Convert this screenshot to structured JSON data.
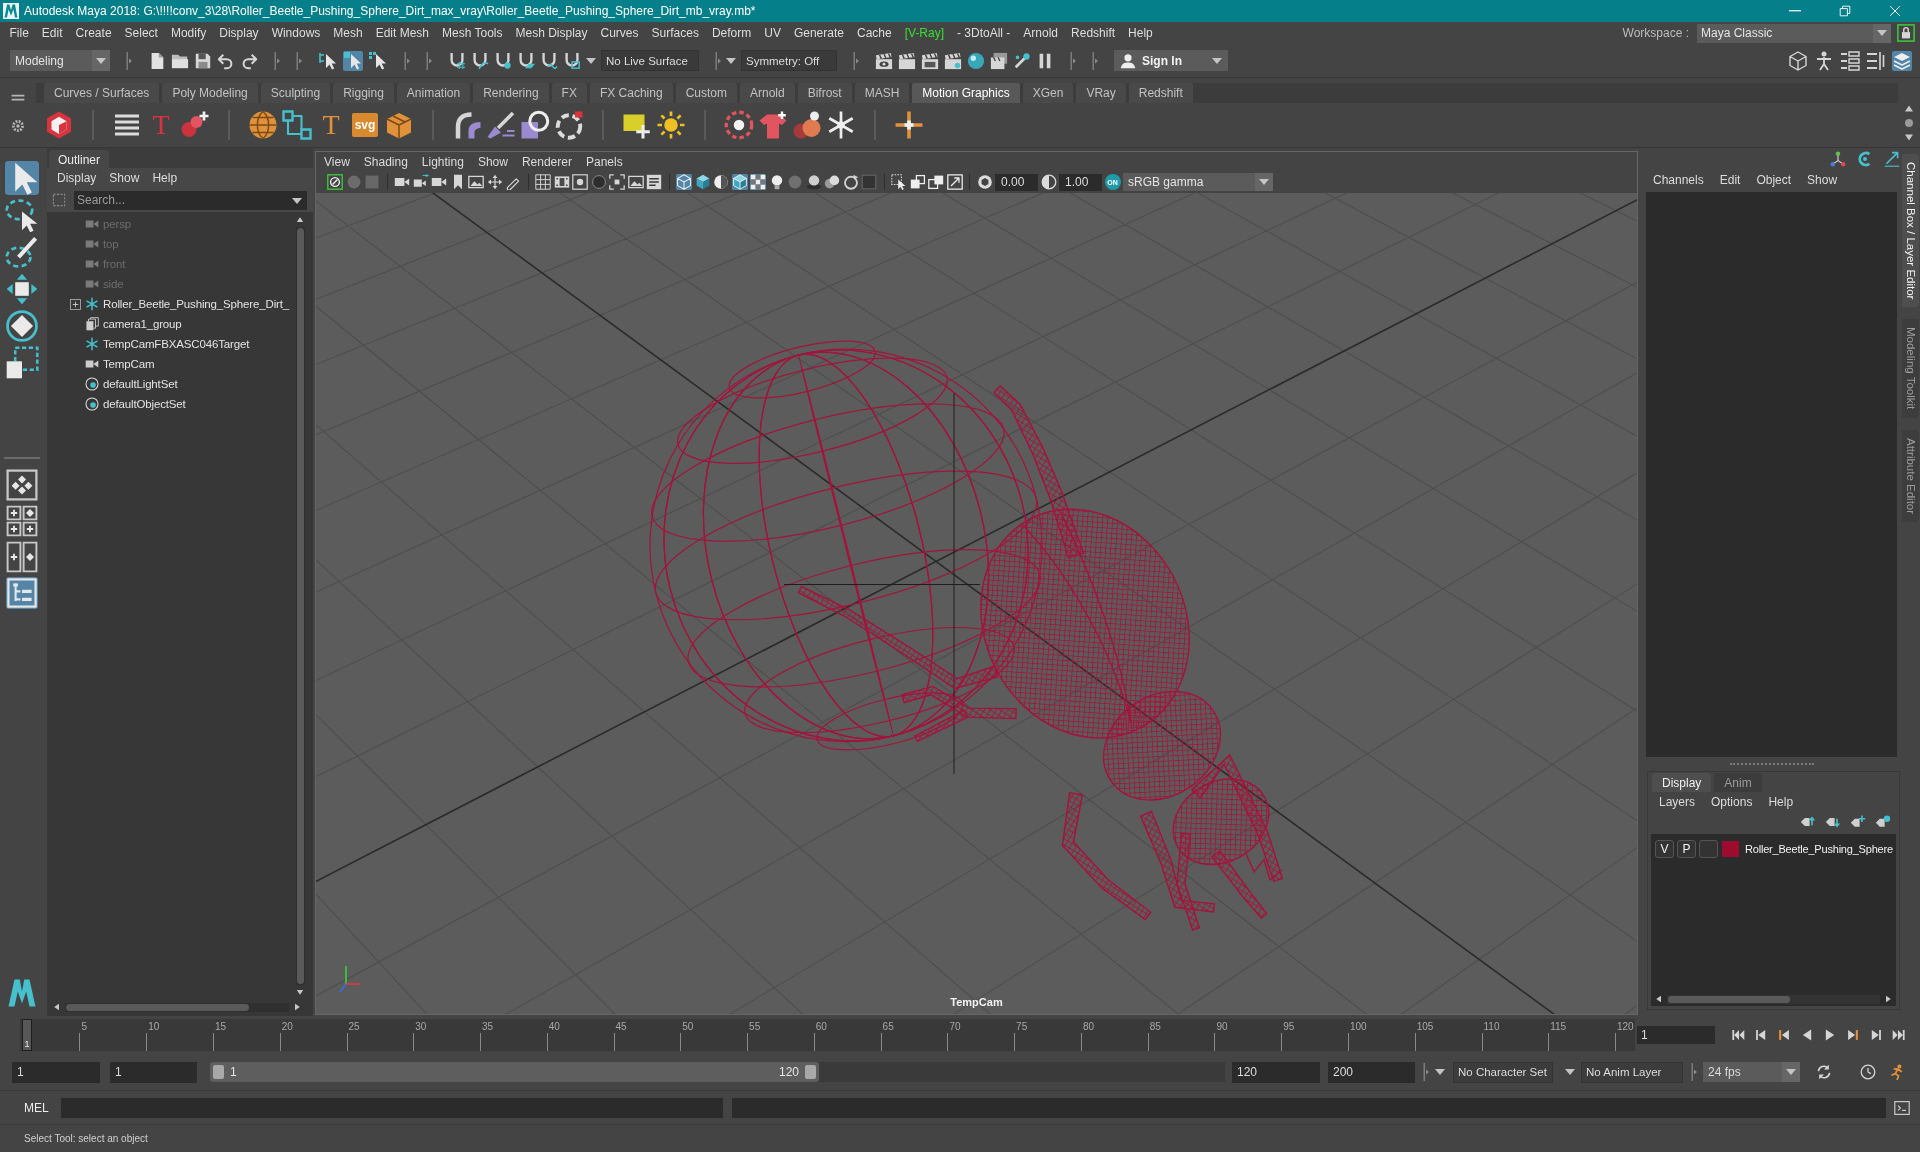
{
  "window": {
    "title": "Autodesk Maya 2018: G:\\!!!!conv_3\\28\\Roller_Beetle_Pushing_Sphere_Dirt_max_vray\\Roller_Beetle_Pushing_Sphere_Dirt_mb_vray.mb*"
  },
  "menu_bar": {
    "items": [
      {
        "label": "File",
        "kind": "menu"
      },
      {
        "label": "Edit",
        "kind": "menu"
      },
      {
        "label": "Create",
        "kind": "menu"
      },
      {
        "label": "Select",
        "kind": "menu"
      },
      {
        "label": "Modify",
        "kind": "menu"
      },
      {
        "label": "Display",
        "kind": "menu"
      },
      {
        "label": "Windows",
        "kind": "menu"
      },
      {
        "label": "Mesh",
        "kind": "menu"
      },
      {
        "label": "Edit Mesh",
        "kind": "menu"
      },
      {
        "label": "Mesh Tools",
        "kind": "menu"
      },
      {
        "label": "Mesh Display",
        "kind": "menu"
      },
      {
        "label": "Curves",
        "kind": "menu"
      },
      {
        "label": "Surfaces",
        "kind": "menu"
      },
      {
        "label": "Deform",
        "kind": "menu"
      },
      {
        "label": "UV",
        "kind": "menu"
      },
      {
        "label": "Generate",
        "kind": "menu"
      },
      {
        "label": "Cache",
        "kind": "menu"
      },
      {
        "label": "[V-Ray]",
        "kind": "plugin"
      },
      {
        "label": "- 3DtoAll -",
        "kind": "menu"
      },
      {
        "label": "Arnold",
        "kind": "menu"
      },
      {
        "label": "Redshift",
        "kind": "menu"
      },
      {
        "label": "Help",
        "kind": "menu"
      }
    ],
    "workspace_label": "Workspace :",
    "workspace": "Maya Classic"
  },
  "status_line": {
    "mode": "Modeling",
    "selection_mask": [
      {
        "selected": false
      },
      {
        "selected": true
      },
      {
        "selected": false
      }
    ],
    "live_surface": "No Live Surface",
    "symmetry": "Symmetry: Off",
    "sign_in": "Sign In",
    "panel_toggles": [
      {
        "on": false
      },
      {
        "on": false
      },
      {
        "on": false
      },
      {
        "on": false
      },
      {
        "on": true
      }
    ]
  },
  "shelf": {
    "tabs": [
      {
        "label": "Curves / Surfaces",
        "selected": false
      },
      {
        "label": "Poly Modeling",
        "selected": false
      },
      {
        "label": "Sculpting",
        "selected": false
      },
      {
        "label": "Rigging",
        "selected": false
      },
      {
        "label": "Animation",
        "selected": false
      },
      {
        "label": "Rendering",
        "selected": false
      },
      {
        "label": "FX",
        "selected": false
      },
      {
        "label": "FX Caching",
        "selected": false
      },
      {
        "label": "Custom",
        "selected": false
      },
      {
        "label": "Arnold",
        "selected": false
      },
      {
        "label": "Bifrost",
        "selected": false
      },
      {
        "label": "MASH",
        "selected": false
      },
      {
        "label": "Motion Graphics",
        "selected": true
      },
      {
        "label": "XGen",
        "selected": false
      },
      {
        "label": "VRay",
        "selected": false
      },
      {
        "label": "Redshift",
        "selected": false
      }
    ],
    "text_tools": [
      "T",
      "T",
      "svg"
    ]
  },
  "toolbox": {
    "tools": [
      {
        "selected": true
      },
      {
        "selected": false
      },
      {
        "selected": false
      },
      {
        "selected": false
      },
      {
        "selected": false
      },
      {
        "selected": false
      }
    ],
    "layouts": [
      {
        "selected": false
      },
      {
        "selected": false
      },
      {
        "selected": false
      },
      {
        "selected": true
      }
    ]
  },
  "outliner": {
    "title": "Outliner",
    "menu": [
      "Display",
      "Show",
      "Help"
    ],
    "search": {
      "placeholder": "Search..."
    },
    "items": [
      {
        "label": "persp",
        "kind": "camera",
        "dimmed": true,
        "expandable": false
      },
      {
        "label": "top",
        "kind": "camera",
        "dimmed": true,
        "expandable": false
      },
      {
        "label": "front",
        "kind": "camera",
        "dimmed": true,
        "expandable": false
      },
      {
        "label": "side",
        "kind": "camera",
        "dimmed": true,
        "expandable": false
      },
      {
        "label": "Roller_Beetle_Pushing_Sphere_Dirt_",
        "kind": "locator",
        "dimmed": false,
        "expandable": true
      },
      {
        "label": "camera1_group",
        "kind": "group",
        "dimmed": false,
        "expandable": false
      },
      {
        "label": "TempCamFBXASC046Target",
        "kind": "locator",
        "dimmed": false,
        "expandable": false
      },
      {
        "label": "TempCam",
        "kind": "camera",
        "dimmed": false,
        "expandable": false
      },
      {
        "label": "defaultLightSet",
        "kind": "set",
        "dimmed": false,
        "expandable": false
      },
      {
        "label": "defaultObjectSet",
        "kind": "set",
        "dimmed": false,
        "expandable": false
      }
    ]
  },
  "viewport": {
    "menu": [
      "View",
      "Shading",
      "Lighting",
      "Show",
      "Renderer",
      "Panels"
    ],
    "shading_toggles": [
      {
        "on": true
      },
      {
        "on": false
      },
      {
        "on": false
      },
      {
        "on": true
      },
      {
        "on": true
      },
      {
        "on": false
      },
      {
        "on": false
      },
      {
        "on": false
      },
      {
        "on": false
      },
      {
        "on": false
      },
      {
        "on": false
      }
    ],
    "exposure": "0.00",
    "gamma": "1.00",
    "color_management": "ON",
    "color_space": "sRGB gamma",
    "camera": "TempCam"
  },
  "channel_box": {
    "menu": [
      "Channels",
      "Edit",
      "Object",
      "Show"
    ]
  },
  "layer_editor": {
    "tabs": [
      {
        "label": "Display",
        "selected": true
      },
      {
        "label": "Anim",
        "selected": false
      }
    ],
    "menu": [
      "Layers",
      "Options",
      "Help"
    ],
    "layers": [
      {
        "visibility": "V",
        "playback": "P",
        "color": "#9b0c2f",
        "name": "Roller_Beetle_Pushing_Sphere"
      }
    ]
  },
  "side_tabs": [
    {
      "label": "Channel Box / Layer Editor",
      "selected": true
    },
    {
      "label": "Modeling Toolkit",
      "selected": false
    },
    {
      "label": "Attribute Editor",
      "selected": false
    }
  ],
  "time_slider": {
    "ticks": [
      "5",
      "10",
      "15",
      "20",
      "25",
      "30",
      "35",
      "40",
      "45",
      "50",
      "55",
      "60",
      "65",
      "70",
      "75",
      "80",
      "85",
      "90",
      "95",
      "100",
      "105",
      "110",
      "115",
      "120"
    ],
    "playhead": {
      "label": "1",
      "level": 0
    },
    "current_frame": "1"
  },
  "range_slider": {
    "start": "1",
    "playback_start": "1",
    "range_start": "1",
    "range_end": "120",
    "level": 0.6,
    "playback_end": "120",
    "end": "200",
    "character_set": "No Character Set",
    "anim_layer": "No Anim Layer",
    "fps": "24 fps"
  },
  "command_line": {
    "language": "MEL"
  },
  "help_line": {
    "text": "Select Tool: select an object"
  }
}
